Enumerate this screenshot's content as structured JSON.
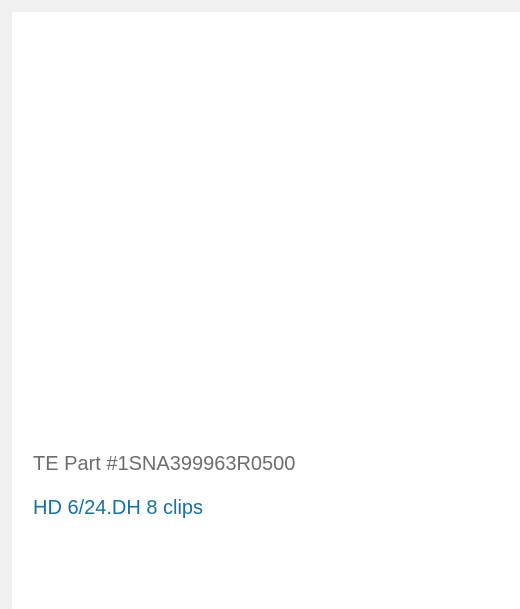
{
  "product": {
    "part_number": "TE Part #1SNA399963R0500",
    "name": "HD 6/24.DH 8 clips"
  },
  "colors": {
    "part_number_text": "#6d6d6d",
    "product_link": "#1a6fa3",
    "border": "#f0f0f0"
  }
}
